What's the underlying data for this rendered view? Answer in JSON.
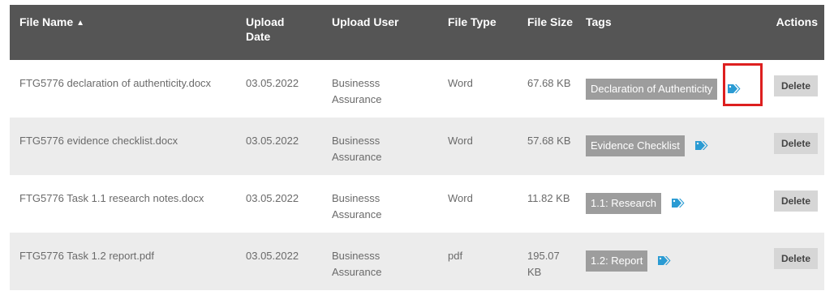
{
  "columns": {
    "file_name": "File Name",
    "sort_indicator": "▲",
    "upload_date": "Upload Date",
    "upload_user": "Upload User",
    "file_type": "File Type",
    "file_size": "File Size",
    "tags": "Tags",
    "actions": "Actions"
  },
  "rows": [
    {
      "file_name": "FTG5776 declaration of authenticity.docx",
      "upload_date": "03.05.2022",
      "upload_user": "Businesss Assurance",
      "file_type": "Word",
      "file_size": "67.68 KB",
      "tag": "Declaration of Authenticity",
      "delete_label": "Delete"
    },
    {
      "file_name": "FTG5776 evidence checklist.docx",
      "upload_date": "03.05.2022",
      "upload_user": "Businesss Assurance",
      "file_type": "Word",
      "file_size": "57.68 KB",
      "tag": "Evidence Checklist",
      "delete_label": "Delete"
    },
    {
      "file_name": "FTG5776 Task 1.1 research notes.docx",
      "upload_date": "03.05.2022",
      "upload_user": "Businesss Assurance",
      "file_type": "Word",
      "file_size": "11.82 KB",
      "tag": "1.1: Research",
      "delete_label": "Delete"
    },
    {
      "file_name": "FTG5776 Task 1.2 report.pdf",
      "upload_date": "03.05.2022",
      "upload_user": "Businesss Assurance",
      "file_type": "pdf",
      "file_size": "195.07 KB",
      "tag": "1.2: Report",
      "delete_label": "Delete"
    }
  ],
  "icons": {
    "tag": "tag-icon",
    "sort": "sort-ascending-icon"
  },
  "colors": {
    "header_bg": "#555555",
    "row_alt_bg": "#ececec",
    "tag_bg": "#9d9d9d",
    "tag_icon": "#2a9bd3",
    "highlight": "#dd1f1f",
    "delete_bg": "#d6d6d6"
  }
}
